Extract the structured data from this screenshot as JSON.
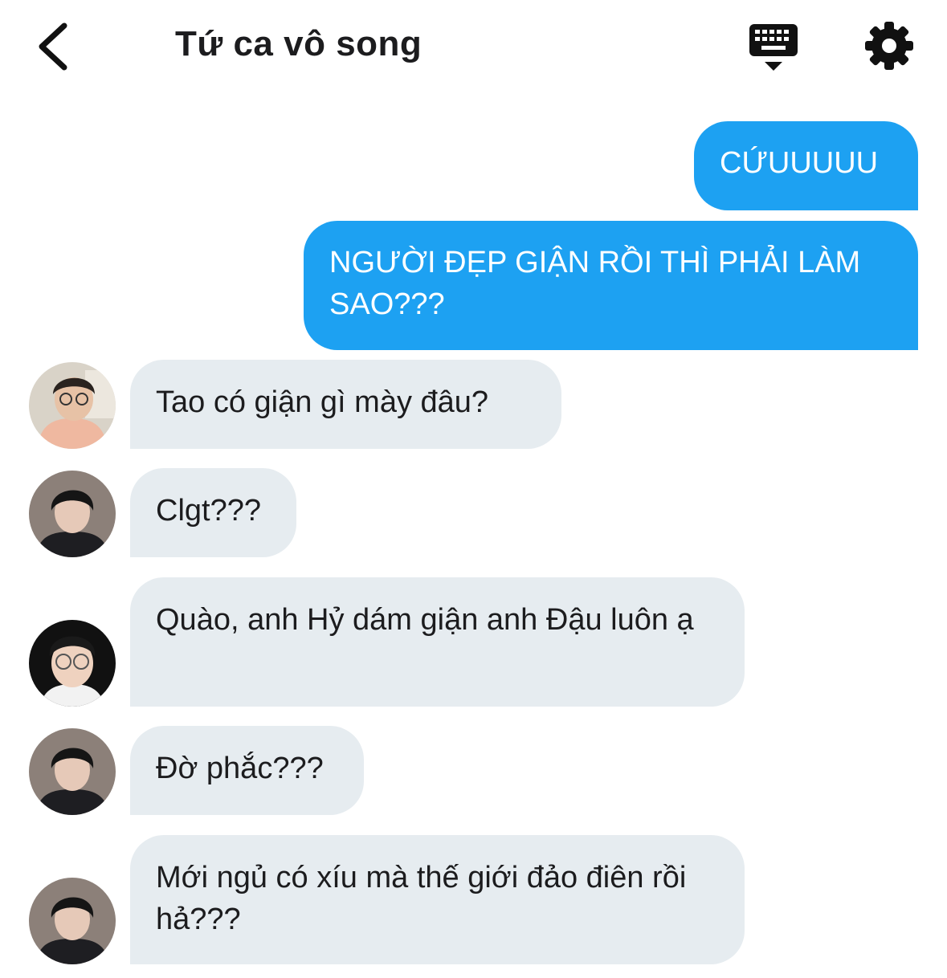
{
  "header": {
    "title": "Tứ ca vô song",
    "back_icon": "chevron-left-icon",
    "keyboard_icon": "keyboard-icon",
    "settings_icon": "gear-icon"
  },
  "colors": {
    "outgoing_bubble": "#1da1f2",
    "incoming_bubble": "#e6ecf0",
    "text": "#1c1c1e"
  },
  "messages": [
    {
      "direction": "outgoing",
      "text": "CỨUUUUU"
    },
    {
      "direction": "outgoing",
      "text": "NGƯỜI ĐẸP GIẬN RỒI THÌ PHẢI LÀM SAO???"
    },
    {
      "direction": "incoming",
      "avatar": "avatar-glasses-orange-shirt",
      "text": "Tao có giận gì mày đâu?"
    },
    {
      "direction": "incoming",
      "avatar": "avatar-black-hair",
      "text": "Clgt???"
    },
    {
      "direction": "incoming",
      "avatar": "avatar-round-glasses",
      "text": "Quào, anh Hỷ dám giận anh Đậu luôn ạ"
    },
    {
      "direction": "incoming",
      "avatar": "avatar-black-hair",
      "text": "Đờ phắc???"
    },
    {
      "direction": "incoming",
      "avatar": "avatar-black-hair",
      "text": "Mới ngủ có xíu mà thế giới đảo điên rồi hả???"
    }
  ]
}
